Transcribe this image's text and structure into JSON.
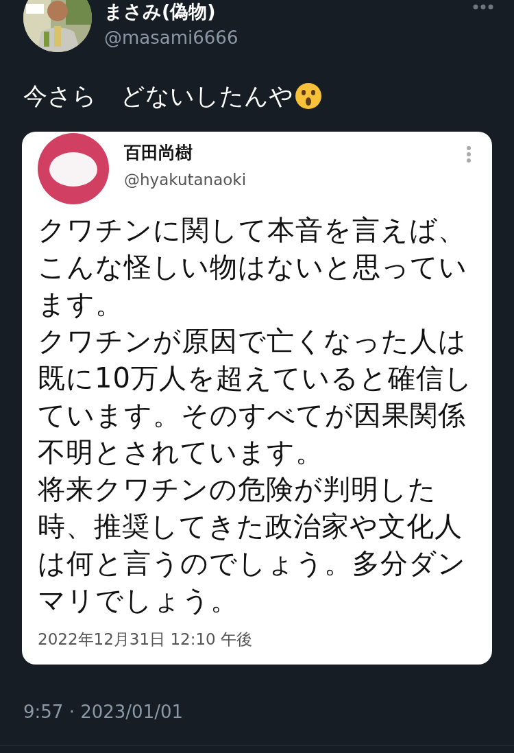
{
  "tweet": {
    "display_name": "まさみ(偽物)",
    "handle": "@masami6666",
    "text": "今さら　どないしたんや",
    "timestamp": "9:57 · 2023/01/01"
  },
  "quoted_tweet": {
    "display_name": "百田尚樹",
    "handle": "@hyakutanaoki",
    "lines": [
      "クワチンに関して本音を言えば、",
      "こんな怪しい物はないと思ってい",
      "ます。",
      "クワチンが原因で亡くなった人は",
      "既に10万人を超えていると確信し",
      "ています。そのすべてが因果関係",
      "不明とされています。",
      "将来クワチンの危険が判明した",
      "時、推奨してきた政治家や文化人",
      "は何と言うのでしょう。多分ダン",
      "マリでしょう。"
    ],
    "timestamp": "2022年12月31日 12:10 午後"
  }
}
